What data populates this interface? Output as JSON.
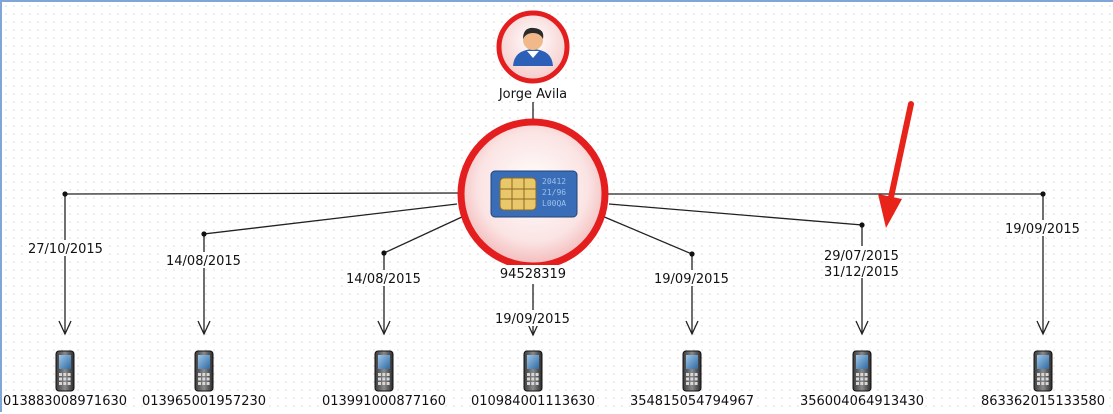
{
  "person": {
    "name": "Jorge Avila"
  },
  "sim": {
    "number": "94528319",
    "card_text": [
      "20412",
      "21/96",
      "L00QA"
    ]
  },
  "devices": [
    {
      "imei": "013883008971630",
      "dates": [
        "27/10/2015"
      ]
    },
    {
      "imei": "013965001957230",
      "dates": [
        "14/08/2015"
      ]
    },
    {
      "imei": "013991000877160",
      "dates": [
        "14/08/2015"
      ]
    },
    {
      "imei": "010984001113630",
      "dates": [
        "19/09/2015"
      ]
    },
    {
      "imei": "354815054794967",
      "dates": [
        "19/09/2015"
      ]
    },
    {
      "imei": "356004064913430",
      "dates": [
        "29/07/2015",
        "31/12/2015"
      ]
    },
    {
      "imei": "863362015133580",
      "dates": [
        "19/09/2015"
      ]
    }
  ],
  "colors": {
    "highlight": "#e41e1e",
    "edge": "#222222",
    "arrow": "#e8231a"
  }
}
